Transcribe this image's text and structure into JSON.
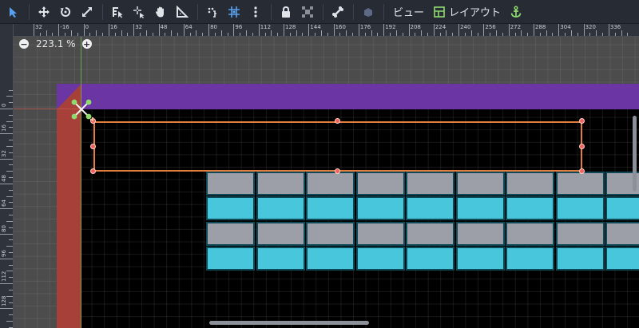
{
  "toolbar": {
    "tools": [
      {
        "name": "select-tool",
        "icon": "arrow-cursor-icon",
        "active": true
      },
      {
        "name": "move-tool",
        "icon": "move-arrows-icon"
      },
      {
        "name": "rotate-tool",
        "icon": "rotate-icon"
      },
      {
        "name": "scale-tool",
        "icon": "scale-icon"
      },
      {
        "name": "list-select-tool",
        "icon": "list-select-icon"
      },
      {
        "name": "pivot-tool",
        "icon": "pivot-icon"
      },
      {
        "name": "pan-tool",
        "icon": "hand-icon"
      },
      {
        "name": "ruler-tool",
        "icon": "ruler-icon"
      },
      {
        "name": "smart-snap-toggle",
        "icon": "snap-icon"
      },
      {
        "name": "grid-snap-toggle",
        "icon": "grid-snap-icon",
        "active": true
      },
      {
        "name": "snap-options-menu",
        "icon": "kebab-menu-icon"
      },
      {
        "name": "lock-toggle",
        "icon": "lock-icon"
      },
      {
        "name": "group-toggle",
        "icon": "group-icon"
      },
      {
        "name": "skeleton-toggle",
        "icon": "bone-icon"
      },
      {
        "name": "camera-override",
        "icon": "camera-icon"
      }
    ],
    "view_label": "ビュー",
    "layout_label": "レイアウト",
    "anchor_icon": "anchor-icon"
  },
  "rulers": {
    "top": [
      "32",
      "-16",
      "0",
      "16",
      "32",
      "48",
      "64",
      "80",
      "96",
      "112",
      "128",
      "144",
      "160",
      "176",
      "192",
      "208",
      "224",
      "240",
      "256",
      "272",
      "288",
      "304",
      "320",
      "336"
    ],
    "left": [
      "0",
      "16",
      "32",
      "48",
      "64",
      "80",
      "96",
      "112",
      "128"
    ]
  },
  "zoom": {
    "minus": "−",
    "value": "223.1 %",
    "plus": "+"
  },
  "colors": {
    "accent": "#5aa0f0",
    "selection": "#e27e3f",
    "handle": "#f0625c",
    "purple_panel": "#6b35a3",
    "red_panel": "#a8403a",
    "tile_gray": "#9c9ea8",
    "tile_cyan": "#48c7dc"
  }
}
